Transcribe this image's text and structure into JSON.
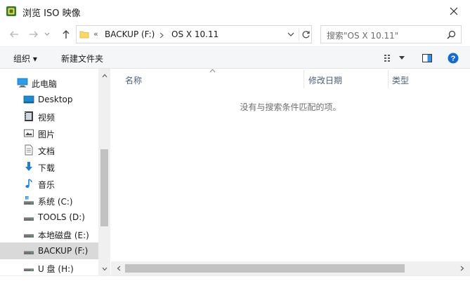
{
  "window": {
    "title": "浏览 ISO 映像"
  },
  "address": {
    "overflow": "«",
    "crumbs": [
      "BACKUP (F:)",
      "OS X 10.11"
    ]
  },
  "search": {
    "placeholder": "搜索\"OS X 10.11\""
  },
  "toolbar": {
    "organize_label": "组织 ▾",
    "new_folder_label": "新建文件夹"
  },
  "sidebar": {
    "items": [
      {
        "label": "此电脑",
        "icon": "computer-icon"
      },
      {
        "label": "Desktop",
        "icon": "desktop-folder-icon"
      },
      {
        "label": "视频",
        "icon": "video-folder-icon"
      },
      {
        "label": "图片",
        "icon": "pictures-folder-icon"
      },
      {
        "label": "文档",
        "icon": "documents-folder-icon"
      },
      {
        "label": "下载",
        "icon": "downloads-folder-icon"
      },
      {
        "label": "音乐",
        "icon": "music-folder-icon"
      },
      {
        "label": "系统 (C:)",
        "icon": "system-drive-icon"
      },
      {
        "label": "TOOLS (D:)",
        "icon": "drive-icon"
      },
      {
        "label": "本地磁盘 (E:)",
        "icon": "drive-icon"
      },
      {
        "label": "BACKUP (F:)",
        "icon": "drive-icon",
        "selected": true
      },
      {
        "label": "U 盘 (H:)",
        "icon": "usb-drive-icon"
      }
    ]
  },
  "columns": {
    "name": "名称",
    "modified": "修改日期",
    "type": "类型"
  },
  "main": {
    "empty_message": "没有与搜索条件匹配的项。"
  },
  "colors": {
    "accent": "#0078d7",
    "selection": "#d9d9d9",
    "toolbar_bg": "#f5f6f7",
    "header_text": "#4c607a"
  }
}
